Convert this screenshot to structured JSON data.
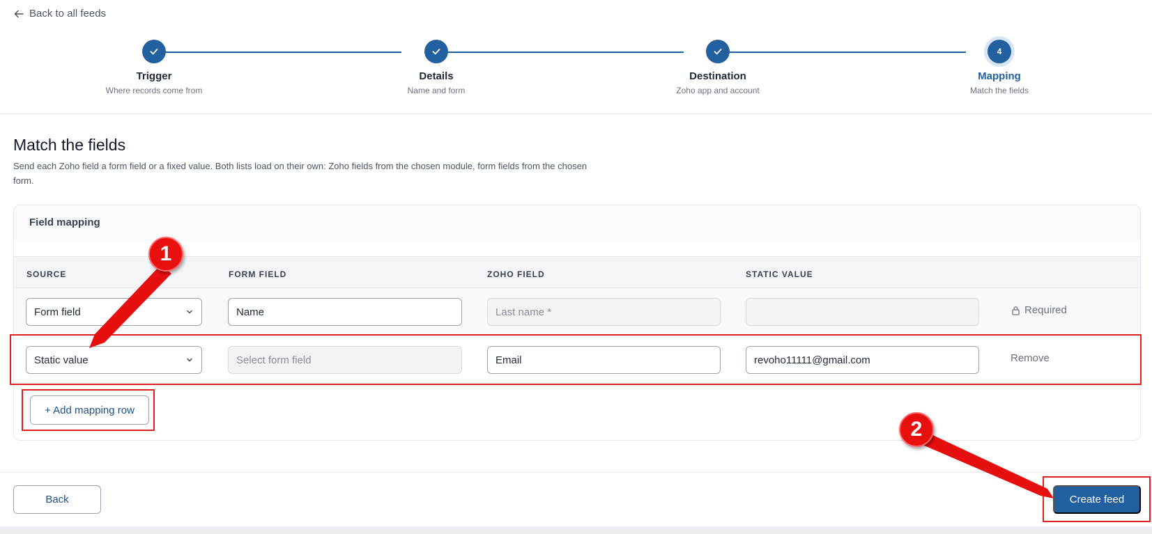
{
  "header": {
    "back_label": "Back to all feeds"
  },
  "stepper": {
    "steps": [
      {
        "number": "1",
        "title": "Trigger",
        "subtitle": "Where records come from",
        "state": "done"
      },
      {
        "number": "2",
        "title": "Details",
        "subtitle": "Name and form",
        "state": "done"
      },
      {
        "number": "3",
        "title": "Destination",
        "subtitle": "Zoho app and account",
        "state": "done"
      },
      {
        "number": "4",
        "title": "Mapping",
        "subtitle": "Match the fields",
        "state": "active"
      }
    ]
  },
  "main": {
    "title": "Match the fields",
    "description": "Send each Zoho field a form field or a fixed value. Both lists load on their own: Zoho fields from the chosen module, form fields from the chosen form."
  },
  "mapping": {
    "card_title": "Field mapping",
    "columns": [
      "SOURCE",
      "FORM FIELD",
      "ZOHO FIELD",
      "STATIC VALUE"
    ],
    "rows": [
      {
        "source": "Form field",
        "form_field": "Name",
        "zoho_field_placeholder": "Last name *",
        "static_value": "",
        "action": "Required"
      },
      {
        "source": "Static value",
        "form_field_placeholder": "Select form field",
        "zoho_field": "Email",
        "static_value": "revoho11111@gmail.com",
        "action": "Remove"
      }
    ],
    "add_row_label": "+ Add mapping row"
  },
  "footer": {
    "back_label": "Back",
    "create_label": "Create feed"
  },
  "annotations": {
    "badge_1": "1",
    "badge_2": "2"
  },
  "colors": {
    "primary": "#23609f",
    "annotation_red": "#e02020"
  }
}
